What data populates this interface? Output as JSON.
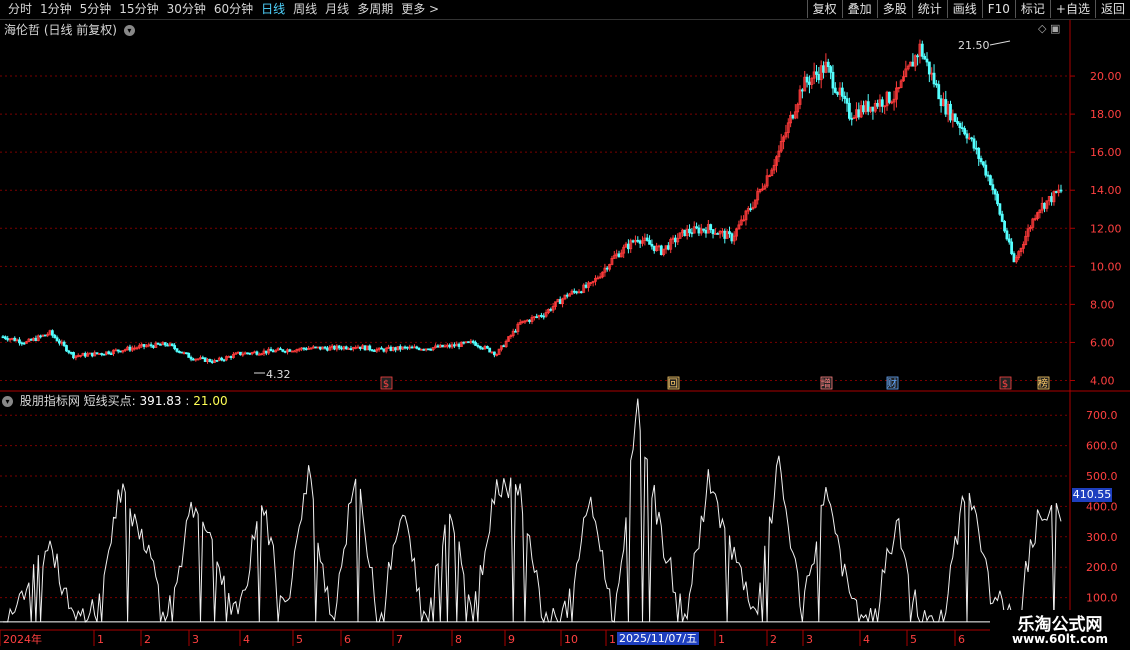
{
  "toolbar": {
    "periods": [
      "分时",
      "1分钟",
      "5分钟",
      "15分钟",
      "30分钟",
      "60分钟",
      "日线",
      "周线",
      "月线",
      "多周期",
      "更多 >"
    ],
    "active_index": 6,
    "right_buttons": [
      "复权",
      "叠加",
      "多股",
      "统计",
      "画线",
      "F10",
      "标记",
      "+自选",
      "返回"
    ]
  },
  "title": "海伦哲 (日线 前复权)",
  "price_axis": [
    "20.00",
    "18.00",
    "16.00",
    "14.00",
    "12.00",
    "10.00",
    "8.00",
    "6.00",
    "4.00"
  ],
  "price_annotations": {
    "high": "21.50",
    "low": "4.32"
  },
  "event_markers": [
    {
      "label": "$",
      "x": 386,
      "color": "#ff4444"
    },
    {
      "label": "回",
      "x": 673,
      "color": "#ffcc66"
    },
    {
      "label": "增",
      "x": 826,
      "color": "#ff8080"
    },
    {
      "label": "财",
      "x": 892,
      "color": "#66aaff"
    },
    {
      "label": "$",
      "x": 1005,
      "color": "#ff4444"
    },
    {
      "label": "榜",
      "x": 1043,
      "color": "#ffcc66"
    }
  ],
  "indicator": {
    "name": "股朋指标网",
    "label": "短线买点:",
    "value1": "391.83",
    "sep": ":",
    "value2": "21.00",
    "axis": [
      "700.0",
      "600.0",
      "500.0",
      "400.0",
      "300.0",
      "200.0",
      "100.0"
    ],
    "current_badge": "410.55"
  },
  "date_axis": {
    "labels": [
      {
        "t": "2024年",
        "x": 3
      },
      {
        "t": "1",
        "x": 97
      },
      {
        "t": "2",
        "x": 144
      },
      {
        "t": "3",
        "x": 192
      },
      {
        "t": "4",
        "x": 243
      },
      {
        "t": "5",
        "x": 296
      },
      {
        "t": "6",
        "x": 344
      },
      {
        "t": "7",
        "x": 396
      },
      {
        "t": "8",
        "x": 455
      },
      {
        "t": "9",
        "x": 508
      },
      {
        "t": "10",
        "x": 564
      },
      {
        "t": "1",
        "x": 609
      },
      {
        "t": "1",
        "x": 718
      },
      {
        "t": "2",
        "x": 770
      },
      {
        "t": "3",
        "x": 806
      },
      {
        "t": "4",
        "x": 863
      },
      {
        "t": "5",
        "x": 910
      },
      {
        "t": "6",
        "x": 958
      }
    ],
    "highlight": "2025/11/07/五"
  },
  "watermark": {
    "line1": "乐淘公式网",
    "line2": "www.60lt.com"
  },
  "chart_data": {
    "type": "line",
    "title": "",
    "series": [
      {
        "name": "海伦哲",
        "x_index": [
          0,
          5,
          10,
          15,
          20,
          25,
          30,
          35,
          40,
          45,
          50,
          55,
          60,
          65,
          70,
          75,
          80,
          85,
          90,
          95,
          100,
          105,
          110,
          115,
          120,
          125,
          130,
          135,
          140,
          145,
          150,
          155,
          160,
          165,
          170,
          175,
          180,
          185,
          190,
          195,
          200,
          205,
          210,
          215,
          220,
          225
        ],
        "values": [
          6.3,
          6.0,
          6.5,
          5.3,
          5.4,
          5.6,
          5.8,
          5.9,
          5.2,
          5.0,
          5.4,
          5.5,
          5.6,
          5.7,
          5.7,
          5.8,
          5.6,
          5.7,
          5.7,
          5.8,
          6.0,
          5.4,
          7.0,
          7.5,
          8.5,
          9.0,
          10.5,
          11.5,
          10.8,
          11.8,
          12.0,
          11.5,
          13.5,
          16.0,
          19.5,
          20.5,
          18.0,
          18.5,
          19.0,
          21.5,
          18.5,
          17.0,
          14.5,
          10.2,
          13.0,
          14.0
        ]
      },
      {
        "name": "短线买点",
        "x_index": [
          0,
          5,
          10,
          15,
          20,
          25,
          30,
          35,
          40,
          45,
          50,
          55,
          60,
          65,
          70,
          75,
          80,
          85,
          90,
          95,
          100,
          105,
          110,
          115,
          120,
          125,
          130,
          135,
          140,
          145,
          150,
          155,
          160,
          165,
          170,
          175,
          180,
          185,
          190,
          195,
          200,
          205,
          210,
          215,
          220,
          225
        ],
        "values": [
          20,
          150,
          280,
          20,
          80,
          450,
          300,
          40,
          380,
          250,
          20,
          420,
          50,
          500,
          20,
          510,
          40,
          380,
          20,
          420,
          40,
          480,
          460,
          20,
          60,
          430,
          20,
          720,
          300,
          20,
          480,
          260,
          20,
          540,
          40,
          470,
          100,
          20,
          350,
          20,
          20,
          500,
          120,
          20,
          350,
          380
        ]
      }
    ],
    "ylim_price": [
      3.5,
      22
    ],
    "ylim_indicator": [
      0,
      750
    ]
  }
}
